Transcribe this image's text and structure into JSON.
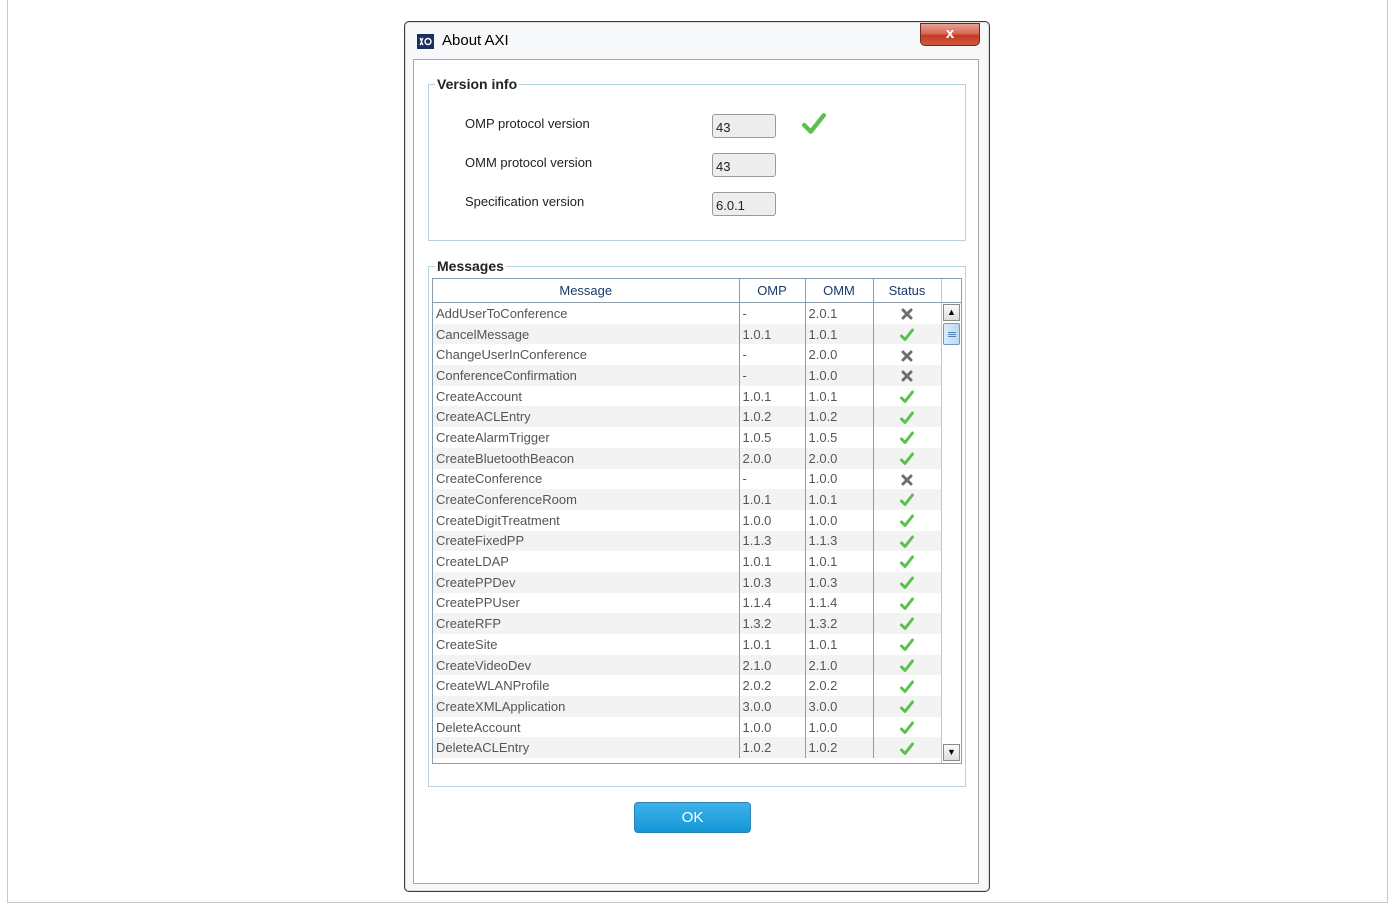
{
  "dialog": {
    "title": "About AXI",
    "close_label": "x"
  },
  "version_info": {
    "legend": "Version info",
    "rows": [
      {
        "label": "OMP protocol version",
        "value": "43",
        "check": true
      },
      {
        "label": "OMM protocol version",
        "value": "43",
        "check": false
      },
      {
        "label": "Specification version",
        "value": "6.0.1",
        "check": false
      }
    ]
  },
  "messages": {
    "legend": "Messages",
    "columns": [
      "Message",
      "OMP",
      "OMM",
      "Status"
    ],
    "rows": [
      {
        "message": "AddUserToConference",
        "omp": "-",
        "omm": "2.0.1",
        "status": "fail"
      },
      {
        "message": "CancelMessage",
        "omp": "1.0.1",
        "omm": "1.0.1",
        "status": "ok"
      },
      {
        "message": "ChangeUserInConference",
        "omp": "-",
        "omm": "2.0.0",
        "status": "fail"
      },
      {
        "message": "ConferenceConfirmation",
        "omp": "-",
        "omm": "1.0.0",
        "status": "fail"
      },
      {
        "message": "CreateAccount",
        "omp": "1.0.1",
        "omm": "1.0.1",
        "status": "ok"
      },
      {
        "message": "CreateACLEntry",
        "omp": "1.0.2",
        "omm": "1.0.2",
        "status": "ok"
      },
      {
        "message": "CreateAlarmTrigger",
        "omp": "1.0.5",
        "omm": "1.0.5",
        "status": "ok"
      },
      {
        "message": "CreateBluetoothBeacon",
        "omp": "2.0.0",
        "omm": "2.0.0",
        "status": "ok"
      },
      {
        "message": "CreateConference",
        "omp": "-",
        "omm": "1.0.0",
        "status": "fail"
      },
      {
        "message": "CreateConferenceRoom",
        "omp": "1.0.1",
        "omm": "1.0.1",
        "status": "ok"
      },
      {
        "message": "CreateDigitTreatment",
        "omp": "1.0.0",
        "omm": "1.0.0",
        "status": "ok"
      },
      {
        "message": "CreateFixedPP",
        "omp": "1.1.3",
        "omm": "1.1.3",
        "status": "ok"
      },
      {
        "message": "CreateLDAP",
        "omp": "1.0.1",
        "omm": "1.0.1",
        "status": "ok"
      },
      {
        "message": "CreatePPDev",
        "omp": "1.0.3",
        "omm": "1.0.3",
        "status": "ok"
      },
      {
        "message": "CreatePPUser",
        "omp": "1.1.4",
        "omm": "1.1.4",
        "status": "ok"
      },
      {
        "message": "CreateRFP",
        "omp": "1.3.2",
        "omm": "1.3.2",
        "status": "ok"
      },
      {
        "message": "CreateSite",
        "omp": "1.0.1",
        "omm": "1.0.1",
        "status": "ok"
      },
      {
        "message": "CreateVideoDev",
        "omp": "2.1.0",
        "omm": "2.1.0",
        "status": "ok"
      },
      {
        "message": "CreateWLANProfile",
        "omp": "2.0.2",
        "omm": "2.0.2",
        "status": "ok"
      },
      {
        "message": "CreateXMLApplication",
        "omp": "3.0.0",
        "omm": "3.0.0",
        "status": "ok"
      },
      {
        "message": "DeleteAccount",
        "omp": "1.0.0",
        "omm": "1.0.0",
        "status": "ok"
      },
      {
        "message": "DeleteACLEntry",
        "omp": "1.0.2",
        "omm": "1.0.2",
        "status": "ok"
      }
    ]
  },
  "ok_button": "OK",
  "colors": {
    "check": "#5cc04e",
    "cross": "#6e6e6e",
    "ok_button": "#1a9ad8",
    "group_border": "#b6d3e2"
  }
}
